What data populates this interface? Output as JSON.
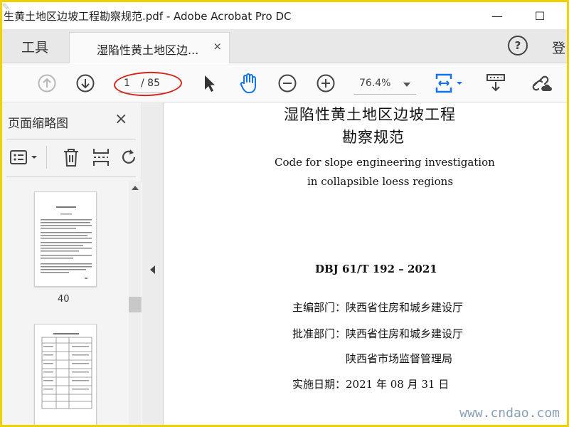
{
  "window": {
    "title": "生黄土地区边坡工程勘察规范.pdf - Adobe Acrobat Pro DC",
    "minimize": "—",
    "maximize": "☐"
  },
  "tabs": {
    "tools_label": "工具",
    "doc_tab_label": "湿陷性黄土地区边...",
    "doc_tab_close": "×",
    "help": "?",
    "login": "登"
  },
  "toolbar": {
    "current_page": "1",
    "total_pages": "/ 85",
    "zoom": "76.4%"
  },
  "left_panel": {
    "title": "页面缩略图",
    "close": "×",
    "thumbnails": [
      {
        "label": "40"
      },
      {
        "label": ""
      }
    ]
  },
  "document": {
    "title_line1": "湿陷性黄土地区边坡工程",
    "title_line2": "勘察规范",
    "en_line1": "Code for slope engineering investigation",
    "en_line2": "in collapsible loess regions",
    "code": "DBJ 61/T 192 – 2021",
    "editor_label": "主编部门：",
    "editor_value": "陕西省住房和城乡建设厅",
    "approver_label": "批准部门：",
    "approver_value1": "陕西省住房和城乡建设厅",
    "approver_value2": "陕西省市场监督管理局",
    "date_label": "实施日期：",
    "date_value": "2021 年 08 月 31 日"
  },
  "watermark": "www.cndao.com",
  "icons": [
    "prev-page-icon",
    "next-page-icon",
    "select-arrow-icon",
    "hand-tool-icon",
    "zoom-out-icon",
    "zoom-in-icon",
    "fit-page-icon",
    "scroll-mode-icon",
    "share-link-icon",
    "options-icon",
    "delete-icon",
    "insert-icon",
    "rotate-icon"
  ]
}
